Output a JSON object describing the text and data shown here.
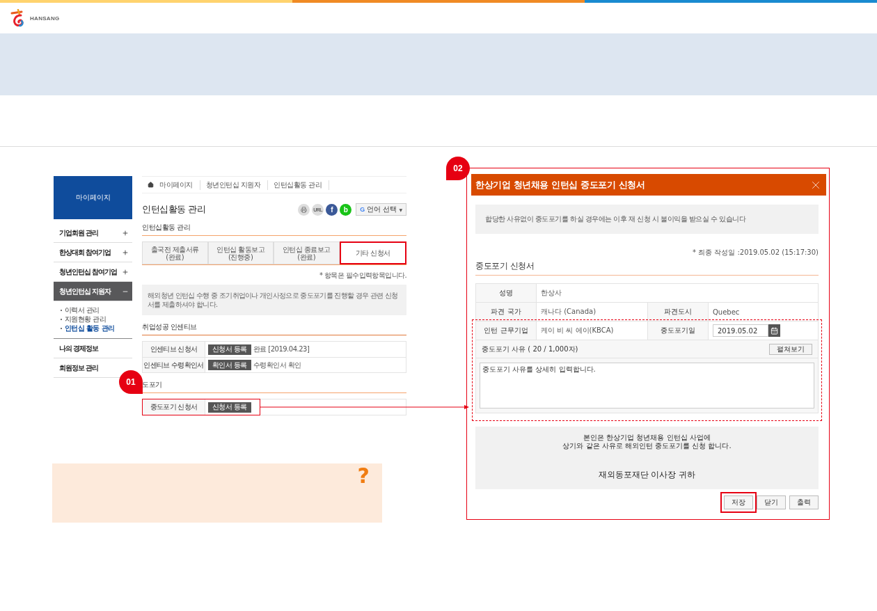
{
  "header": {
    "logo_text": "HANSANG"
  },
  "callouts": [
    "01",
    "02"
  ],
  "sidebar": {
    "title": "마이페이지",
    "items": [
      {
        "label": "기업회원 관리",
        "kind": "toggle",
        "expanded": false,
        "selected": false
      },
      {
        "label": "한상대회 참여기업",
        "kind": "toggle",
        "expanded": false,
        "selected": false
      },
      {
        "label": "청년인턴십 참여기업",
        "kind": "toggle",
        "expanded": false,
        "selected": false
      },
      {
        "label": "청년인턴십 지원자",
        "kind": "toggle",
        "expanded": true,
        "selected": true,
        "children": [
          {
            "label": "이력서 관리",
            "selected": false
          },
          {
            "label": "지원현황 관리",
            "selected": false
          },
          {
            "label": "인턴십 활동 관리",
            "selected": true
          }
        ]
      },
      {
        "label": "나의 경제정보",
        "kind": "plain",
        "selected": false
      },
      {
        "label": "회원정보 관리",
        "kind": "plain",
        "selected": false
      }
    ]
  },
  "breadcrumb": [
    "마이페이지",
    "청년인턴십 지원자",
    "인턴십활동 관리"
  ],
  "page_title": "인턴십활동 관리",
  "share_buttons": [
    {
      "kind": "print"
    },
    {
      "kind": "url",
      "text": "URL"
    },
    {
      "kind": "facebook",
      "text": "f"
    },
    {
      "kind": "band",
      "text": "b"
    }
  ],
  "language_select": {
    "logo": "G",
    "label": "언어 선택",
    "arrow": "▼"
  },
  "activity": {
    "heading": "인턴십활동 관리",
    "tabs": [
      {
        "label": "출국전 제출서류",
        "status": "(완료)",
        "selected": false
      },
      {
        "label": "인턴십 활동보고",
        "status": "(진행중)",
        "selected": false
      },
      {
        "label": "인턴십 종료보고",
        "status": "(완료)",
        "selected": false
      },
      {
        "label": "기타 신청서",
        "selected": true
      }
    ]
  },
  "required_note": "* 항목은 필수입력항목입니다.",
  "notice": "해외청년 인턴십 수행 중 조기취업이나 개인사정으로 중도포기를 진행할 경우 관련 신청서를 제출하셔야 합니다.",
  "incentive": {
    "heading": "취업성공 인센티브",
    "rows": [
      {
        "label": "인센티브 신청서",
        "button": "신청서 등록",
        "status": "완료 [2019.04.23]",
        "highlighted": false
      },
      {
        "label": "인센티브 수령확인서",
        "button": "확인서 등록",
        "status": "수령확인서 확인",
        "highlighted": false
      }
    ]
  },
  "withdrawal": {
    "heading": "도포기",
    "rows": [
      {
        "label": "중도포기 신청서",
        "button": "신청서 등록",
        "highlighted": true
      }
    ]
  },
  "help_box": {
    "mark": "?"
  },
  "dialog": {
    "title": "한상기업 청년채용 인턴십 중도포기 신청서",
    "notice": "합당한 사유없이 중도포기를 하실 경우에는 이후 재 신청 시 불이익을 받으실 수 있습니다",
    "last_saved": "* 최종 작성일 :2019.05.02 (15:17:30)",
    "section": "중도포기 신청서",
    "name": {
      "label": "성명",
      "value": "한상사"
    },
    "country": {
      "label": "파견 국가",
      "value": "캐나다 (Canada)"
    },
    "city": {
      "label": "파견도시",
      "value": "Quebec"
    },
    "company": {
      "label": "인턴 근무기업",
      "value": "케이 비 씨 에이(KBCA)"
    },
    "date": {
      "label": "중도포기일",
      "value": "2019.05.02"
    },
    "reason": {
      "label": "중도포기 사유 ( 20 / 1,000자)",
      "expand_button": "펼쳐보기",
      "value": "중도포기 사유를 상세히 입력합니다."
    },
    "pledge": {
      "lines": [
        "본인은 한상기업 청년채용 인턴십 사업에",
        "상기와 같은 사유로 해외인턴 중도포기를 신청 합니다."
      ],
      "addressee": "재외동포재단 이사장 귀하"
    },
    "buttons": [
      {
        "label": "저장",
        "highlighted": true
      },
      {
        "label": "닫기",
        "highlighted": false
      },
      {
        "label": "출력",
        "highlighted": false
      }
    ]
  }
}
